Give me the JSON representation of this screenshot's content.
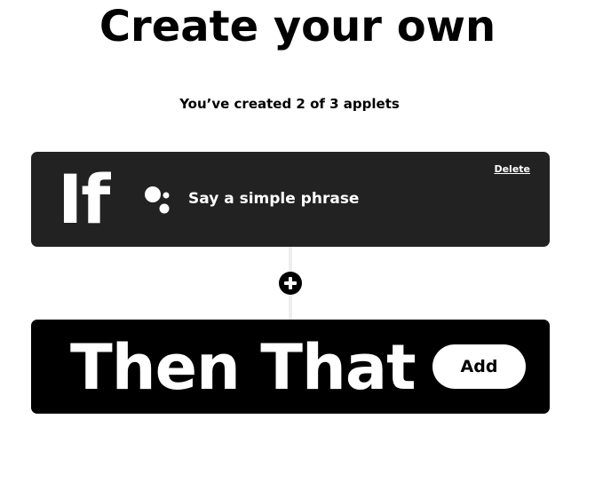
{
  "header": {
    "title": "Create your own",
    "subtitle": "You’ve created 2 of 3 applets"
  },
  "if_card": {
    "keyword": "If",
    "trigger_label": "Say a simple phrase",
    "service_icon": "google-assistant-icon",
    "delete_label": "Delete",
    "background_color": "#222222"
  },
  "connector": {
    "add_step_icon": "plus-icon"
  },
  "then_card": {
    "keyword": "Then That",
    "add_label": "Add",
    "background_color": "#000000"
  }
}
